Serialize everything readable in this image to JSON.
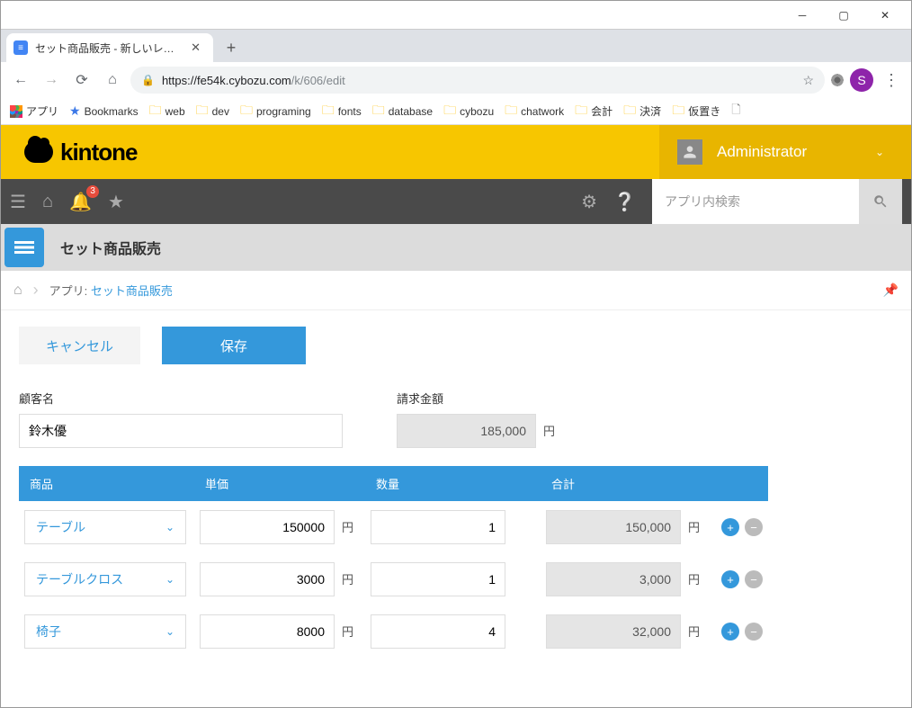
{
  "browser": {
    "tab_title": "セット商品販売 - 新しいレコード",
    "url_host": "https://fe54k.cybozu.com",
    "url_path": "/k/606/edit",
    "user_initial": "S",
    "bookmarks": {
      "apps": "アプリ",
      "bookmarks": "Bookmarks",
      "folders": [
        "web",
        "dev",
        "programing",
        "fonts",
        "database",
        "cybozu",
        "chatwork",
        "会計",
        "決済",
        "仮置き"
      ]
    }
  },
  "header": {
    "logo_text": "kintone",
    "user_name": "Administrator",
    "notif_count": "3",
    "search_placeholder": "アプリ内検索"
  },
  "app": {
    "title": "セット商品販売",
    "breadcrumb_prefix": "アプリ: ",
    "breadcrumb_link": "セット商品販売"
  },
  "buttons": {
    "cancel": "キャンセル",
    "save": "保存"
  },
  "form": {
    "customer_label": "顧客名",
    "customer_value": "鈴木優",
    "total_label": "請求金額",
    "total_value": "185,000",
    "currency": "円"
  },
  "table": {
    "headers": {
      "product": "商品",
      "unit_price": "単価",
      "qty": "数量",
      "subtotal": "合計"
    },
    "rows": [
      {
        "product": "テーブル",
        "unit_price": "150000",
        "qty": "1",
        "subtotal": "150,000"
      },
      {
        "product": "テーブルクロス",
        "unit_price": "3000",
        "qty": "1",
        "subtotal": "3,000"
      },
      {
        "product": "椅子",
        "unit_price": "8000",
        "qty": "4",
        "subtotal": "32,000"
      }
    ]
  }
}
